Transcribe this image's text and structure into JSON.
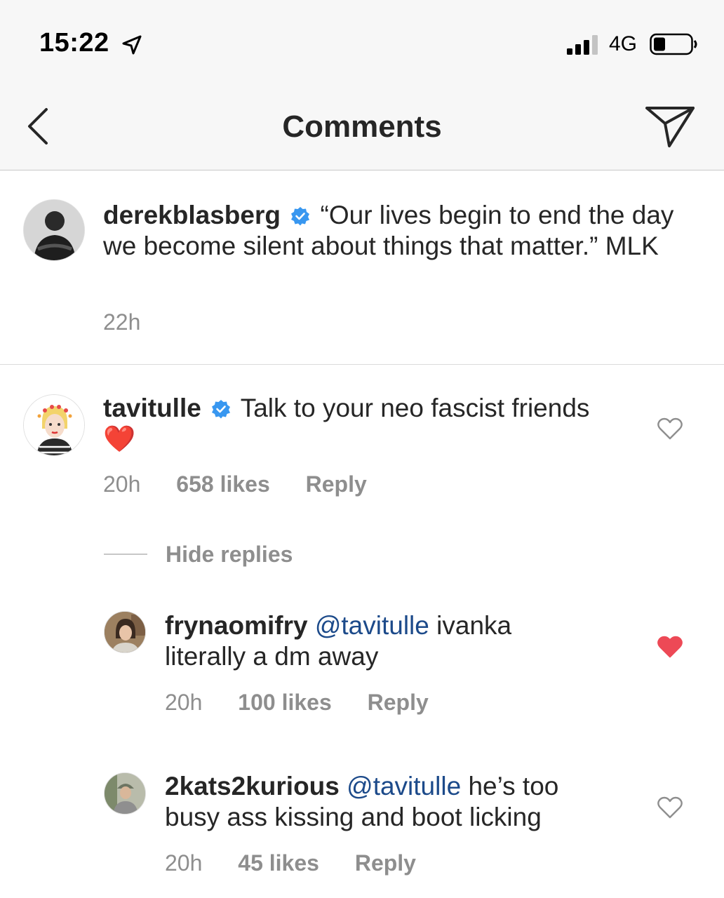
{
  "status": {
    "time": "15:22",
    "network": "4G"
  },
  "nav": {
    "title": "Comments"
  },
  "caption": {
    "username": "derekblasberg",
    "text": "“Our lives begin to end the day we become silent about things that matter.” MLK",
    "time": "22h"
  },
  "comments": [
    {
      "username": "tavitulle",
      "text": "Talk to your neo fascist friends",
      "emoji": "❤️",
      "time": "20h",
      "likes": "658 likes",
      "reply": "Reply",
      "liked": false
    }
  ],
  "hide_replies": "Hide replies",
  "replies": [
    {
      "username": "frynaomifry",
      "mention": "@tavitulle",
      "text": "ivanka literally a dm away",
      "time": "20h",
      "likes": "100 likes",
      "reply": "Reply",
      "liked": true
    },
    {
      "username": "2kats2kurious",
      "mention": "@tavitulle",
      "text": "he’s too busy ass kissing and boot licking",
      "time": "20h",
      "likes": "45 likes",
      "reply": "Reply",
      "liked": false
    }
  ],
  "colors": {
    "heart_liked": "#ed4956",
    "verified": "#3897f0",
    "mention": "#1c4a8a"
  },
  "icons": [
    "location-arrow-icon",
    "signal-icon",
    "battery-icon",
    "back-chevron-icon",
    "send-icon",
    "verified-badge-icon",
    "heart-icon"
  ]
}
